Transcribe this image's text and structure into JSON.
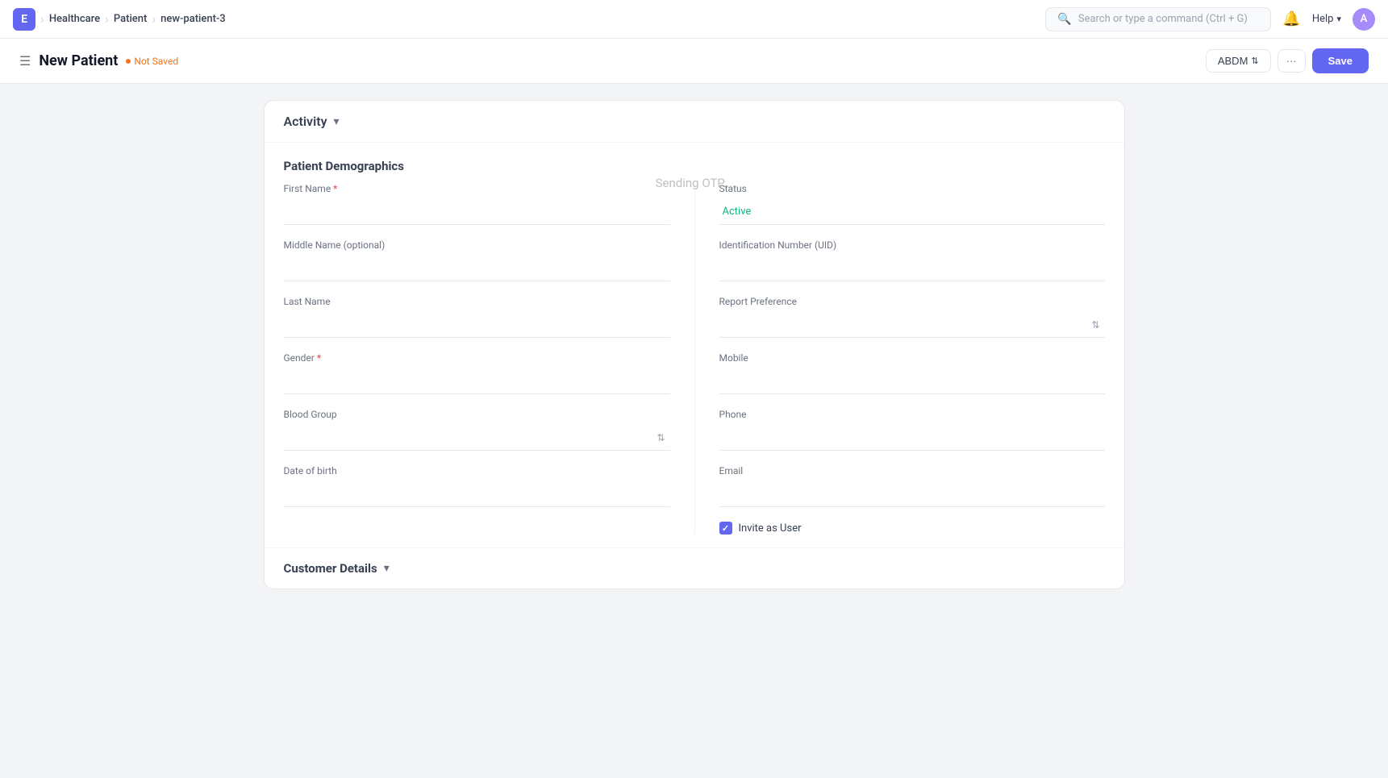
{
  "navbar": {
    "logo": "E",
    "breadcrumbs": [
      "Healthcare",
      "Patient",
      "new-patient-3"
    ],
    "search_placeholder": "Search or type a command (Ctrl + G)",
    "help_label": "Help",
    "avatar_label": "A"
  },
  "page_header": {
    "title": "New Patient",
    "not_saved": "Not Saved",
    "abdm_label": "ABDM",
    "save_label": "Save"
  },
  "activity": {
    "title": "Activity"
  },
  "patient_demographics": {
    "section_title": "Patient Demographics",
    "fields": {
      "first_name_label": "First Name",
      "middle_name_label": "Middle Name (optional)",
      "last_name_label": "Last Name",
      "gender_label": "Gender",
      "blood_group_label": "Blood Group",
      "date_of_birth_label": "Date of birth",
      "status_label": "Status",
      "status_value": "Active",
      "identification_number_label": "Identification Number (UID)",
      "report_preference_label": "Report Preference",
      "mobile_label": "Mobile",
      "phone_label": "Phone",
      "email_label": "Email",
      "invite_as_user_label": "Invite as User"
    }
  },
  "sending_otp_text": "Sending OTP...",
  "customer_details": {
    "title": "Customer Details"
  }
}
